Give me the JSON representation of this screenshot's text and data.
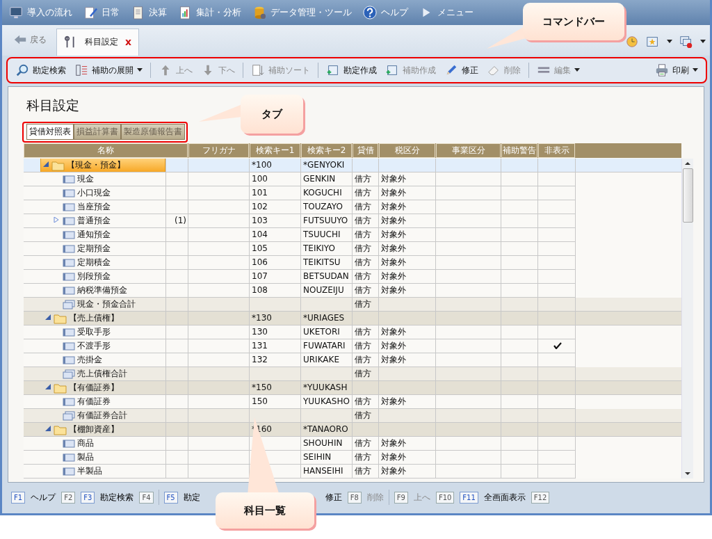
{
  "menu_bar": [
    {
      "label": "導入の流れ"
    },
    {
      "label": "日常"
    },
    {
      "label": "決算"
    },
    {
      "label": "集計・分析"
    },
    {
      "label": "データ管理・ツール"
    },
    {
      "label": "ヘルプ"
    },
    {
      "label": "メニュー"
    }
  ],
  "tab_strip": {
    "back": "戻る",
    "tabs": [
      {
        "label": "科目設定",
        "selected": true,
        "close": "x"
      }
    ]
  },
  "command_bar": [
    {
      "kind": "button",
      "label": "勘定検索",
      "disabled": false
    },
    {
      "kind": "dropdown",
      "label": "補助の展開",
      "disabled": false
    },
    {
      "kind": "separator"
    },
    {
      "kind": "button",
      "label": "上へ",
      "disabled": true
    },
    {
      "kind": "button",
      "label": "下へ",
      "disabled": true
    },
    {
      "kind": "separator"
    },
    {
      "kind": "button",
      "label": "補助ソート",
      "disabled": true
    },
    {
      "kind": "separator"
    },
    {
      "kind": "button",
      "label": "勘定作成",
      "disabled": false
    },
    {
      "kind": "button",
      "label": "補助作成",
      "disabled": true
    },
    {
      "kind": "button",
      "label": "修正",
      "disabled": false
    },
    {
      "kind": "button",
      "label": "削除",
      "disabled": true
    },
    {
      "kind": "separator"
    },
    {
      "kind": "dropdown",
      "label": "編集",
      "disabled": true
    },
    {
      "kind": "spacer"
    },
    {
      "kind": "dropdown",
      "label": "印刷",
      "disabled": false
    }
  ],
  "page_title": "科目設定",
  "sheet_tabs": [
    {
      "label": "貸借対照表",
      "selected": true
    },
    {
      "label": "損益計算書",
      "selected": false
    },
    {
      "label": "製造原価報告書",
      "selected": false
    }
  ],
  "table": {
    "columns": [
      "名称",
      "フリガナ",
      "検索キー1",
      "検索キー2",
      "貸借",
      "税区分",
      "事業区分",
      "補助警告",
      "非表示"
    ],
    "rows": [
      {
        "kind": "group",
        "name": "【現金・預金】",
        "key1": "*100",
        "key2": "*GENYOKI",
        "selected": true,
        "expanded": true,
        "children": [
          {
            "kind": "account",
            "name": "現金",
            "key1": "100",
            "key2": "GENKIN",
            "side": "借方",
            "tax": "対象外",
            "hidden": false
          },
          {
            "kind": "account",
            "name": "小口現金",
            "key1": "101",
            "key2": "KOGUCHI",
            "side": "借方",
            "tax": "対象外",
            "hidden": false
          },
          {
            "kind": "account",
            "name": "当座預金",
            "key1": "102",
            "key2": "TOUZAYO",
            "side": "借方",
            "tax": "対象外",
            "hidden": false
          },
          {
            "kind": "account",
            "name": "普通預金",
            "count": "(1)",
            "expanded": false,
            "key1": "103",
            "key2": "FUTSUUYO",
            "side": "借方",
            "tax": "対象外",
            "hidden": false
          },
          {
            "kind": "account",
            "name": "通知預金",
            "key1": "104",
            "key2": "TSUUCHI",
            "side": "借方",
            "tax": "対象外",
            "hidden": false
          },
          {
            "kind": "account",
            "name": "定期預金",
            "key1": "105",
            "key2": "TEIKIYO",
            "side": "借方",
            "tax": "対象外",
            "hidden": false
          },
          {
            "kind": "account",
            "name": "定期積金",
            "key1": "106",
            "key2": "TEIKITSU",
            "side": "借方",
            "tax": "対象外",
            "hidden": false
          },
          {
            "kind": "account",
            "name": "別段預金",
            "key1": "107",
            "key2": "BETSUDAN",
            "side": "借方",
            "tax": "対象外",
            "hidden": false
          },
          {
            "kind": "account",
            "name": "納税準備預金",
            "key1": "108",
            "key2": "NOUZEIJU",
            "side": "借方",
            "tax": "対象外",
            "hidden": false
          },
          {
            "kind": "total",
            "name": "現金・預金合計",
            "side": "借方"
          }
        ]
      },
      {
        "kind": "group",
        "name": "【売上債権】",
        "key1": "*130",
        "key2": "*URIAGES",
        "selected": false,
        "expanded": true,
        "children": [
          {
            "kind": "account",
            "name": "受取手形",
            "key1": "130",
            "key2": "UKETORI",
            "side": "借方",
            "tax": "対象外",
            "hidden": false
          },
          {
            "kind": "account",
            "name": "不渡手形",
            "key1": "131",
            "key2": "FUWATARI",
            "side": "借方",
            "tax": "対象外",
            "hidden": true
          },
          {
            "kind": "account",
            "name": "売掛金",
            "key1": "132",
            "key2": "URIKAKE",
            "side": "借方",
            "tax": "対象外",
            "hidden": false
          },
          {
            "kind": "total",
            "name": "売上債権合計",
            "side": "借方"
          }
        ]
      },
      {
        "kind": "group",
        "name": "【有価証券】",
        "key1": "*150",
        "key2": "*YUUKASH",
        "selected": false,
        "expanded": true,
        "children": [
          {
            "kind": "account",
            "name": "有価証券",
            "key1": "150",
            "key2": "YUUKASHO",
            "side": "借方",
            "tax": "対象外",
            "hidden": false
          },
          {
            "kind": "total",
            "name": "有価証券合計",
            "side": "借方"
          }
        ]
      },
      {
        "kind": "group",
        "name": "【棚卸資産】",
        "key1": "*160",
        "key2": "*TANAORO",
        "selected": false,
        "expanded": true,
        "children": [
          {
            "kind": "account",
            "name": "商品",
            "key2": "SHOUHIN",
            "side": "借方",
            "tax": "対象外",
            "hidden": false
          },
          {
            "kind": "account",
            "name": "製品",
            "key2": "SEIHIN",
            "side": "借方",
            "tax": "対象外",
            "hidden": false
          },
          {
            "kind": "account",
            "name": "半製品",
            "key2": "HANSEIHI",
            "side": "借方",
            "tax": "対象外",
            "hidden": false
          }
        ]
      }
    ]
  },
  "function_keys": [
    {
      "key": "F1",
      "label": "ヘルプ",
      "disabled": false
    },
    {
      "key": "F2",
      "disabled": true
    },
    {
      "key": "F3",
      "label": "勘定検索",
      "disabled": false
    },
    {
      "key": "F4",
      "disabled": true
    },
    {
      "kind": "separator"
    },
    {
      "key": "F5",
      "label": "勘定",
      "disabled": false
    },
    {
      "label": "修正",
      "disabled": false
    },
    {
      "key": "F8",
      "label": "削除",
      "disabled": true
    },
    {
      "kind": "separator"
    },
    {
      "key": "F9",
      "label": "上へ",
      "disabled": true
    },
    {
      "key": "F10",
      "disabled": true
    },
    {
      "key": "F11",
      "label": "全画面表示",
      "disabled": false
    },
    {
      "key": "F12",
      "disabled": true
    }
  ],
  "callouts": [
    {
      "text": "コマンドバー"
    },
    {
      "text": "タブ"
    },
    {
      "text": "科目一覧"
    }
  ]
}
